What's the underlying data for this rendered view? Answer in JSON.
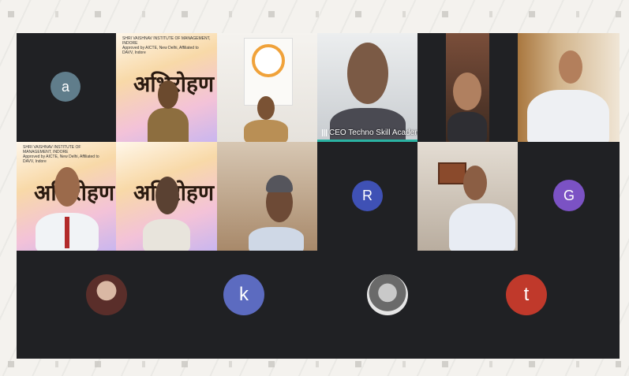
{
  "tiles": {
    "a": {
      "initial": "a",
      "color": "#607d8b"
    },
    "active_speaker": {
      "name": "CEO Techno Skill Academy"
    },
    "r": {
      "initial": "R",
      "color": "#3f51b5"
    },
    "g": {
      "initial": "G",
      "color": "#7b52c4"
    },
    "k": {
      "initial": "k",
      "color": "#5c6bc0"
    },
    "t": {
      "initial": "t",
      "color": "#c0392b"
    }
  },
  "banner_text": {
    "line1": "SHRI VAISHNAV INSTITUTE OF MANAGEMENT, INDORE",
    "line2": "Approved by AICTE, New Delhi, Affiliated to DAVV, Indore",
    "big": "अभिरोहण"
  }
}
